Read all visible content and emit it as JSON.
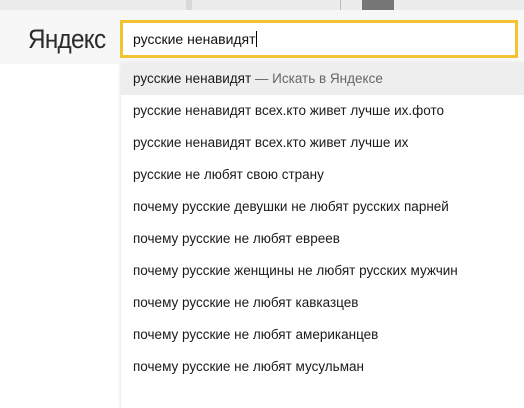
{
  "header": {
    "logo": "Яндекс",
    "search": {
      "value": "русские ненавидят"
    }
  },
  "suggest": {
    "first": {
      "query": "русские ненавидят",
      "hint": " — Искать в Яндексе"
    },
    "items": [
      "русские ненавидят всех.кто живет лучше их.фото",
      "русские ненавидят всех.кто живет лучше их",
      "русские не любят свою страну",
      "почему русские девушки не любят русских парней",
      "почему русские не любят евреев",
      "почему русские женщины не любят русских мужчин",
      "почему русские не любят кавказцев",
      "почему русские не любят американцев",
      "почему русские не любят мусульман"
    ]
  },
  "colors": {
    "search_border": "#f1c232",
    "header_bg": "#f7f7f7",
    "selected_bg": "#eeeeee"
  }
}
